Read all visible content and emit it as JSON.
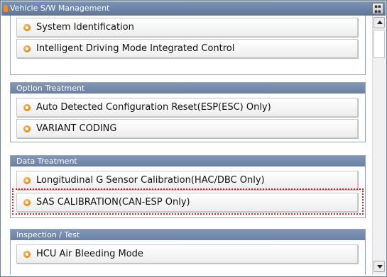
{
  "window": {
    "title": "Vehicle S/W Management"
  },
  "groups": [
    {
      "header": "",
      "items": [
        {
          "label": "System Identification"
        },
        {
          "label": "Intelligent  Driving  Mode  Integrated  Control"
        }
      ]
    },
    {
      "header": "Option Treatment",
      "items": [
        {
          "label": "Auto Detected Configuration Reset(ESP(ESC) Only)"
        },
        {
          "label": "VARIANT CODING"
        }
      ]
    },
    {
      "header": "Data Treatment",
      "items": [
        {
          "label": "Longitudinal  G  Sensor  Calibration(HAC/DBC  Only)"
        },
        {
          "label": "SAS CALIBRATION(CAN-ESP Only)"
        }
      ]
    },
    {
      "header": "Inspection / Test",
      "items": [
        {
          "label": "HCU Air Bleeding Mode"
        }
      ]
    }
  ],
  "highlighted_item": "SAS CALIBRATION(CAN-ESP Only)",
  "colors": {
    "header_blue": "#6b80a3",
    "bullet_orange": "#f08a12",
    "highlight_red": "#e32222"
  }
}
